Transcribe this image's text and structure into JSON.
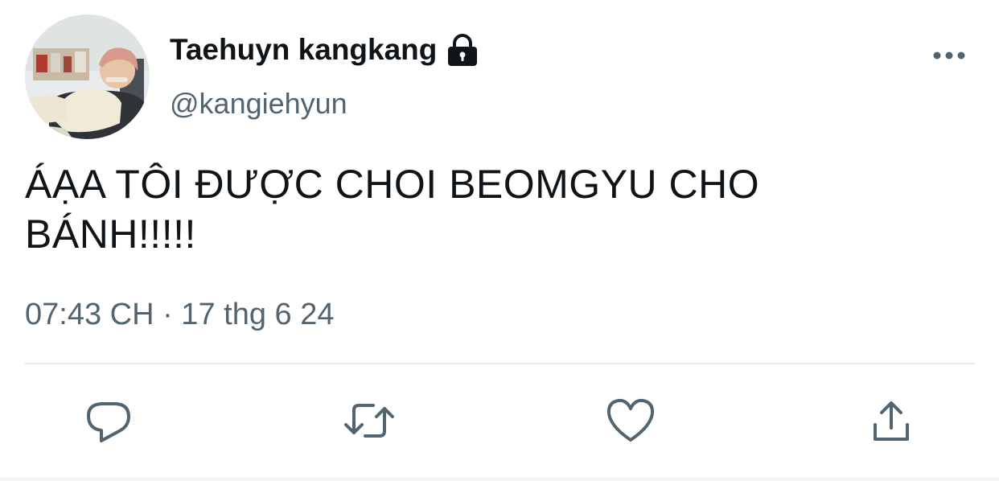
{
  "tweet": {
    "author": {
      "display_name": "Taehuyn kangkang",
      "handle": "@kangiehyun",
      "protected_icon": "lock-icon",
      "avatar": "avatar-photo"
    },
    "text": "ÁẠA TÔI ĐƯỢC CHOI BEOMGYU CHO\nBÁNH!!!!!",
    "timestamp": "07:43 CH · 17 thg 6 24",
    "menu_icon": "more-horizontal-icon"
  },
  "actions": [
    {
      "name": "reply",
      "icon": "comment-icon"
    },
    {
      "name": "retweet",
      "icon": "retweet-icon"
    },
    {
      "name": "like",
      "icon": "heart-icon"
    },
    {
      "name": "share",
      "icon": "share-icon"
    }
  ],
  "colors": {
    "text_primary": "#0f1419",
    "text_secondary": "#536471",
    "icon": "#536471",
    "divider": "#e6ecf0"
  }
}
